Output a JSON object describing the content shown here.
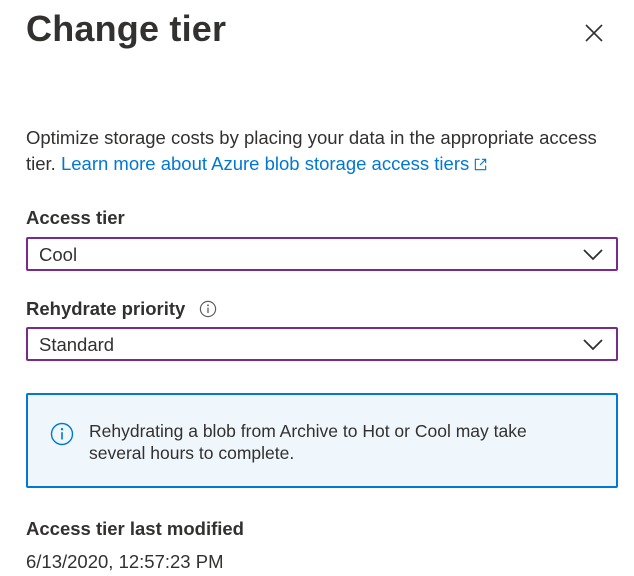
{
  "panel": {
    "title": "Change tier",
    "close_icon": "close-icon"
  },
  "description": {
    "text": "Optimize storage costs by placing your data in the appropriate access tier.",
    "link_text": "Learn more about Azure blob storage access tiers",
    "link_icon": "external-link-icon"
  },
  "access_tier": {
    "label": "Access tier",
    "selected": "Cool"
  },
  "rehydrate_priority": {
    "label": "Rehydrate priority",
    "selected": "Standard",
    "info_icon": "info-icon"
  },
  "info_message": {
    "icon": "info-icon",
    "text": "Rehydrating a blob from Archive to Hot or Cool may take several hours to complete."
  },
  "last_modified": {
    "label": "Access tier last modified",
    "value": "6/13/2020, 12:57:23 PM"
  },
  "colors": {
    "accent": "#0078d4",
    "select_border": "#7a2a8f",
    "info_background": "#eff6fc",
    "text": "#323130"
  }
}
